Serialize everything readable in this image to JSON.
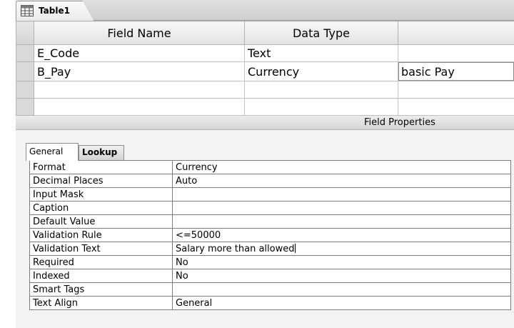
{
  "tab": {
    "title": "Table1",
    "icon": "table-icon"
  },
  "grid": {
    "headers": [
      "Field Name",
      "Data Type",
      ""
    ],
    "rows": [
      {
        "field_name": "E_Code",
        "data_type": "Text",
        "description": ""
      },
      {
        "field_name": "B_Pay",
        "data_type": "Currency",
        "description": "basic Pay"
      },
      {
        "field_name": "",
        "data_type": "",
        "description": ""
      },
      {
        "field_name": "",
        "data_type": "",
        "description": ""
      }
    ]
  },
  "field_properties": {
    "title": "Field Properties",
    "tabs": [
      "General",
      "Lookup"
    ],
    "properties": [
      {
        "name": "Format",
        "value": "Currency"
      },
      {
        "name": "Decimal Places",
        "value": "Auto"
      },
      {
        "name": "Input Mask",
        "value": ""
      },
      {
        "name": "Caption",
        "value": ""
      },
      {
        "name": "Default Value",
        "value": ""
      },
      {
        "name": "Validation Rule",
        "value": "<=50000"
      },
      {
        "name": "Validation Text",
        "value": "Salary more than allowed"
      },
      {
        "name": "Required",
        "value": "No"
      },
      {
        "name": "Indexed",
        "value": "No"
      },
      {
        "name": "Smart Tags",
        "value": ""
      },
      {
        "name": "Text Align",
        "value": "General"
      }
    ]
  }
}
